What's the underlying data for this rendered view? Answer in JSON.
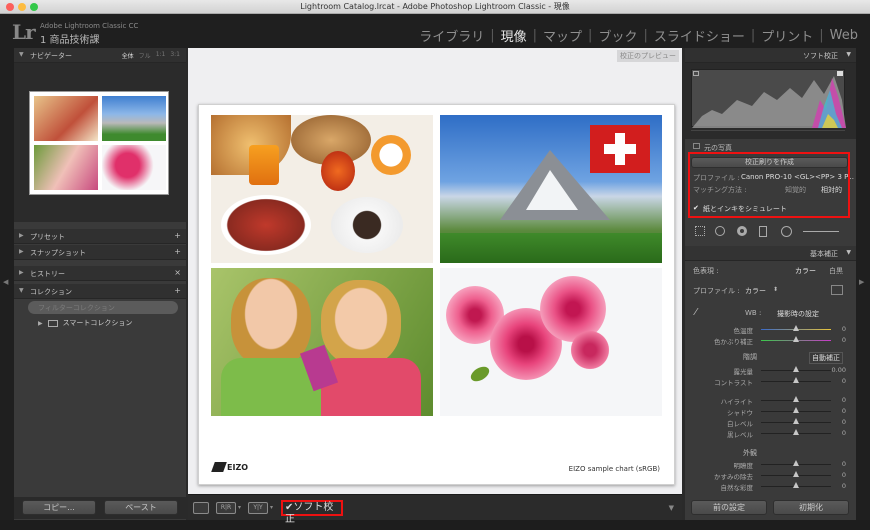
{
  "window": {
    "title": "Lightroom Catalog.lrcat - Adobe Photoshop Lightroom Classic - 現像"
  },
  "identity": {
    "logo": "Lr",
    "product": "Adobe Lightroom Classic CC",
    "catalog": "1 商品技術課"
  },
  "modules": [
    {
      "label": "ライブラリ",
      "active": false
    },
    {
      "label": "現像",
      "active": true
    },
    {
      "label": "マップ",
      "active": false
    },
    {
      "label": "ブック",
      "active": false
    },
    {
      "label": "スライドショー",
      "active": false
    },
    {
      "label": "プリント",
      "active": false
    },
    {
      "label": "Web",
      "active": false
    }
  ],
  "left": {
    "navigator": {
      "label": "ナビゲーター",
      "options": [
        "全体",
        "フル",
        "1:1",
        "3:1"
      ]
    },
    "presets": "プリセット",
    "snapshots": "スナップショット",
    "history": "ヒストリー",
    "collections": "コレクション",
    "filter_placeholder": "フィルターコレクション",
    "smart_collection": "スマートコレクション",
    "copy_button": "コピー...",
    "paste_button": "ペースト"
  },
  "center": {
    "proof_label": "校正のプレビュー",
    "brand": "EIZO",
    "caption": "EIZO sample chart (sRGB)"
  },
  "toolbar": {
    "soft_proof_label": "ソフト校正",
    "soft_proof_checked": true
  },
  "right": {
    "soft_proof_title": "ソフト校正",
    "original_photo": "元の写真",
    "create_proof_copy": "校正刷りを作成",
    "profile_row": {
      "label": "プロファイル :",
      "value": "Canon PRO-10 <GL><PP> 3 P..."
    },
    "intent_row": {
      "label": "マッチング方法 :",
      "perceptual": "知覚的",
      "relative": "相対的"
    },
    "simulate_paper": "紙とインキをシミュレート",
    "basic_title": "基本補正",
    "treatment": {
      "label": "色表現 :",
      "color": "カラー",
      "bw": "白黒"
    },
    "profile": {
      "label": "プロファイル :",
      "value": "カラー"
    },
    "wb": {
      "label": "WB :",
      "value": "撮影時の設定"
    },
    "temp": {
      "label": "色温度",
      "value": "0"
    },
    "tint": {
      "label": "色かぶり補正",
      "value": "0"
    },
    "tone_label": "階調",
    "auto": "自動補正",
    "exposure": {
      "label": "露光量",
      "value": "0.00"
    },
    "contrast": {
      "label": "コントラスト",
      "value": "0"
    },
    "highlights": {
      "label": "ハイライト",
      "value": "0"
    },
    "shadows": {
      "label": "シャドウ",
      "value": "0"
    },
    "whites": {
      "label": "白レベル",
      "value": "0"
    },
    "blacks": {
      "label": "黒レベル",
      "value": "0"
    },
    "presence_label": "外観",
    "clarity": {
      "label": "明瞭度",
      "value": "0"
    },
    "dehaze": {
      "label": "かすみの除去",
      "value": "0"
    },
    "vibrance": {
      "label": "自然な彩度",
      "value": "0"
    },
    "previous_button": "前の設定",
    "reset_button": "初期化"
  },
  "colors": {
    "accent_red": "#e11111",
    "panel_bg": "#3a3a3a",
    "center_bg": "#efeff1"
  }
}
